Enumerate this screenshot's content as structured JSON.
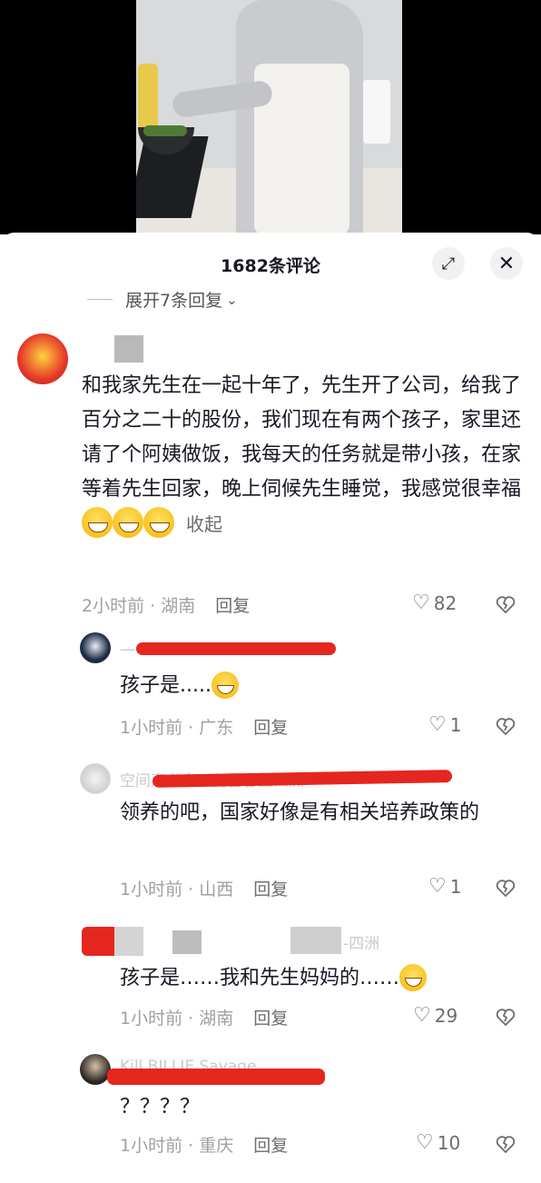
{
  "sheet": {
    "title": "1682条评论",
    "expand_replies": "展开7条回复",
    "expand_icon": "expand-arrows-icon",
    "close_icon": "close-icon"
  },
  "comments": [
    {
      "text": "和我家先生在一起十年了，先生开了公司，给我了百分之二十的股份，我们现在有两个孩子，家里还请了个阿姨做饭，我每天的任务就是带小孩，在家等着先生回家，晚上伺候先生睡觉，我感觉很幸福",
      "collapse": "收起",
      "time": "2小时前 · 湖南",
      "reply": "回复",
      "likes": "82"
    }
  ],
  "replies": [
    {
      "text": "孩子是.....",
      "time": "1小时前 · 广东",
      "reply": "回复",
      "likes": "1"
    },
    {
      "name_fragment": "空间声名白...剑雪容上四洲",
      "text": "领养的吧，国家好像是有相关培养政策的",
      "time": "1小时前 · 山西",
      "reply": "回复",
      "likes": "1"
    },
    {
      "name_fragment": "-四洲",
      "text": "孩子是……我和先生妈妈的……",
      "time": "1小时前 · 湖南",
      "reply": "回复",
      "likes": "29"
    },
    {
      "name_fragment": "Kill BILLIE Savage",
      "text": "？？？？",
      "time": "1小时前 · 重庆",
      "reply": "回复",
      "likes": "10"
    }
  ],
  "colors": {
    "accent_red": "#e5261f",
    "meta_gray": "#a0a0a4"
  }
}
